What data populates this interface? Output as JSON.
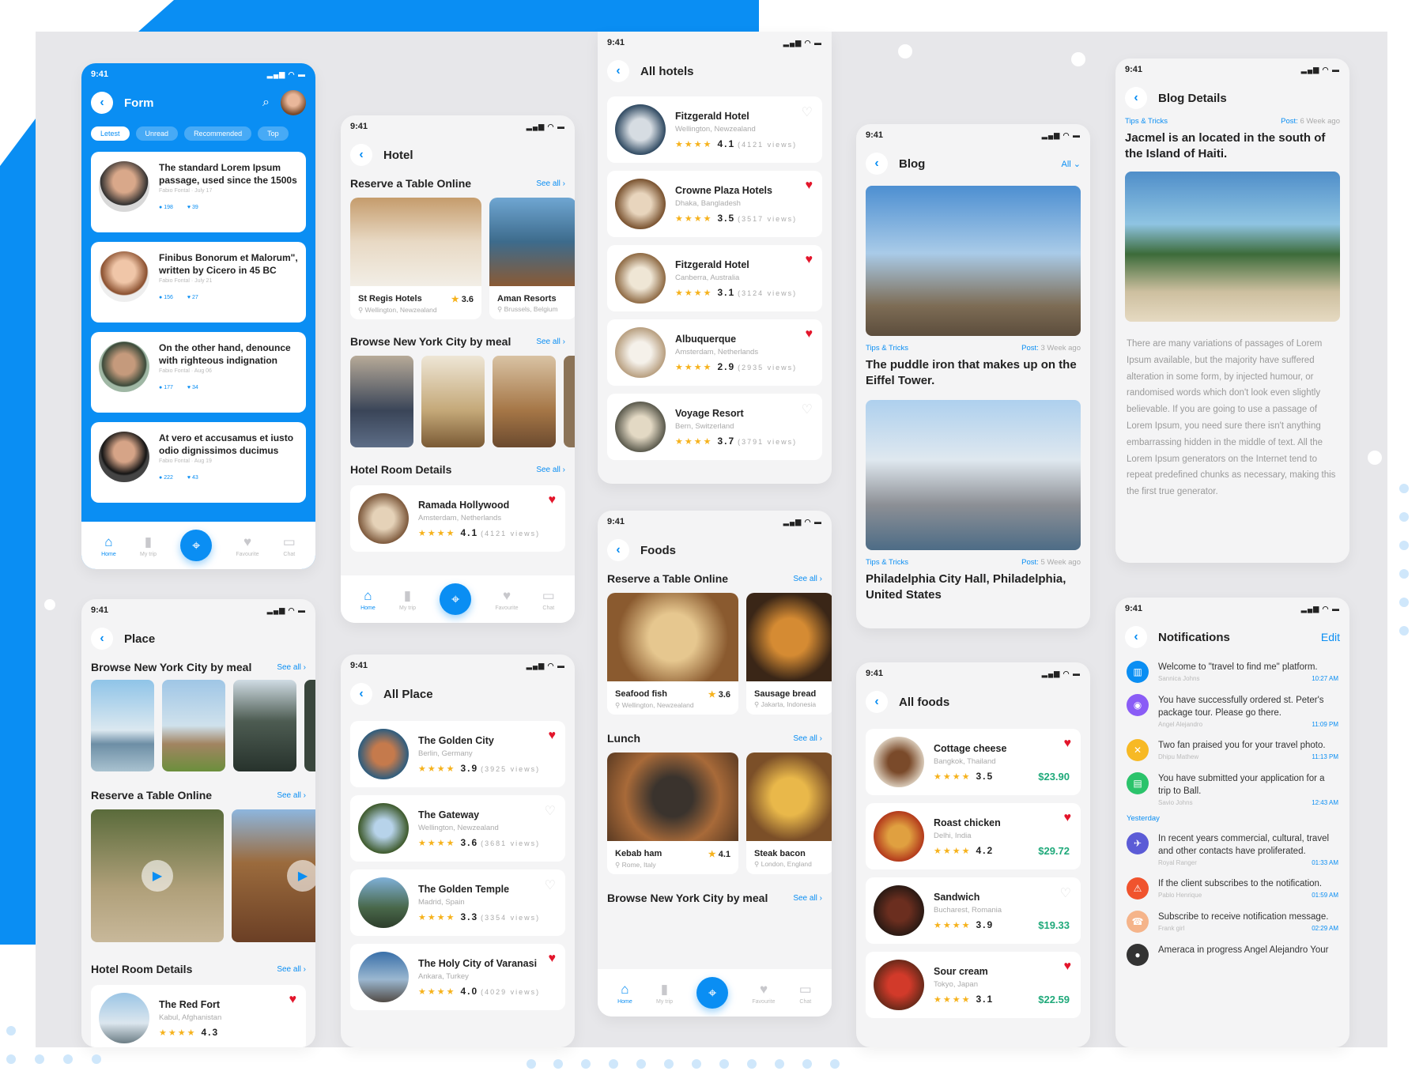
{
  "status_time": "9:41",
  "nav": {
    "home": "Home",
    "trip": "My trip",
    "fav": "Favourite",
    "chat": "Chat"
  },
  "see_all": "See all",
  "form": {
    "title": "Form",
    "tabs": [
      "Letest",
      "Unread",
      "Recommended",
      "Top"
    ],
    "posts": [
      {
        "title": "The standard Lorem Ipsum passage, used since the 1500s",
        "author": "Fabio Fontal",
        "date": "July 17",
        "comments": "198",
        "likes": "39"
      },
      {
        "title": "Finibus Bonorum et Malorum\", written by Cicero in 45 BC",
        "author": "Fabio Fontal",
        "date": "July 21",
        "comments": "156",
        "likes": "27"
      },
      {
        "title": "On the other hand, denounce with righteous indignation",
        "author": "Fabio Fontal",
        "date": "Aug 06",
        "comments": "177",
        "likes": "34"
      },
      {
        "title": "At vero et accusamus et iusto odio dignissimos ducimus",
        "author": "Fabio Fontal",
        "date": "Aug 19",
        "comments": "222",
        "likes": "43"
      }
    ]
  },
  "place": {
    "title": "Place",
    "s1": "Browse New York City by meal",
    "s2": "Reserve a Table Online",
    "s3": "Hotel Room Details",
    "card": {
      "name": "The Red Fort",
      "loc": "Kabul, Afghanistan",
      "rating": "4.3"
    }
  },
  "hotel": {
    "title": "Hotel",
    "s1": "Reserve a Table Online",
    "s2": "Browse New York City by meal",
    "s3": "Hotel Room Details",
    "c1": {
      "name": "St Regis Hotels",
      "loc": "Wellington, Newzealand",
      "rating": "3.6"
    },
    "c2": {
      "name": "Aman Resorts",
      "loc": "Brussels, Belgium"
    },
    "detail": {
      "name": "Ramada Hollywood",
      "loc": "Amsterdam, Netherlands",
      "rating": "4.1",
      "views": "(4121 views)"
    }
  },
  "all_place": {
    "title": "All Place",
    "items": [
      {
        "name": "The Golden City",
        "loc": "Berlin, Germany",
        "rating": "3.9",
        "views": "(3925 views)"
      },
      {
        "name": "The Gateway",
        "loc": "Wellington, Newzealand",
        "rating": "3.6",
        "views": "(3681 views)"
      },
      {
        "name": "The Golden Temple",
        "loc": "Madrid, Spain",
        "rating": "3.3",
        "views": "(3354 views)"
      },
      {
        "name": "The Holy City of Varanasi",
        "loc": "Ankara, Turkey",
        "rating": "4.0",
        "views": "(4029 views)"
      }
    ]
  },
  "all_hotels": {
    "title": "All hotels",
    "items": [
      {
        "name": "Fitzgerald Hotel",
        "loc": "Wellington, Newzealand",
        "rating": "4.1",
        "views": "(4121 views)"
      },
      {
        "name": "Crowne Plaza Hotels",
        "loc": "Dhaka, Bangladesh",
        "rating": "3.5",
        "views": "(3517 views)"
      },
      {
        "name": "Fitzgerald Hotel",
        "loc": "Canberra, Australia",
        "rating": "3.1",
        "views": "(3124 views)"
      },
      {
        "name": "Albuquerque",
        "loc": "Amsterdam, Netherlands",
        "rating": "2.9",
        "views": "(2935 views)"
      },
      {
        "name": "Voyage Resort",
        "loc": "Bern, Switzerland",
        "rating": "3.7",
        "views": "(3791 views)"
      }
    ]
  },
  "foods": {
    "title": "Foods",
    "s1": "Reserve a Table Online",
    "s2": "Lunch",
    "s3": "Browse New York City by meal",
    "c1": {
      "name": "Seafood fish",
      "loc": "Wellington, Newzealand",
      "rating": "3.6"
    },
    "c2": {
      "name": "Sausage bread",
      "loc": "Jakarta, Indonesia"
    },
    "c3": {
      "name": "Kebab ham",
      "loc": "Rome, Italy",
      "rating": "4.1"
    },
    "c4": {
      "name": "Steak bacon",
      "loc": "London, England"
    }
  },
  "blog": {
    "title": "Blog",
    "filter": "All",
    "tag": "Tips & Tricks",
    "post": "Post:",
    "a1": {
      "age": "3 Week ago",
      "title": "The puddle iron that makes up on the Eiffel Tower."
    },
    "a2": {
      "age": "5 Week ago",
      "title": "Philadelphia City Hall, Philadelphia, United States"
    }
  },
  "all_foods": {
    "title": "All foods",
    "items": [
      {
        "name": "Cottage cheese",
        "loc": "Bangkok, Thailand",
        "rating": "3.5",
        "price": "$23.90"
      },
      {
        "name": "Roast chicken",
        "loc": "Delhi, India",
        "rating": "4.2",
        "price": "$29.72"
      },
      {
        "name": "Sandwich",
        "loc": "Bucharest, Romania",
        "rating": "3.9",
        "price": "$19.33"
      },
      {
        "name": "Sour cream",
        "loc": "Tokyo, Japan",
        "rating": "3.1",
        "price": "$22.59"
      }
    ]
  },
  "blog_details": {
    "title": "Blog Details",
    "tag": "Tips & Tricks",
    "post": "Post:",
    "age": "6 Week ago",
    "heading": "Jacmel is an located in the south of the Island of Haiti.",
    "body": "There are many variations of passages of Lorem Ipsum available, but the majority have suffered alteration in some form, by injected humour, or randomised words which don't look even slightly believable. If you are going to use a passage of Lorem Ipsum, you need sure there isn't anything embarrassing hidden in the middle of text. All the Lorem Ipsum generators on the Internet tend to repeat predefined chunks as necessary, making this the first true generator."
  },
  "notifications": {
    "title": "Notifications",
    "edit": "Edit",
    "yesterday": "Yesterday",
    "items": [
      {
        "text": "Welcome to \"travel to find me\" platform.",
        "who": "Sannica Johns",
        "time": "10:27 AM",
        "color": "#0a8ef3"
      },
      {
        "text": "You have successfully ordered st. Peter's package tour. Please go there.",
        "who": "Angel Alejandro",
        "time": "11:09 PM",
        "color": "#8a5cf6"
      },
      {
        "text": "Two fan praised you for your travel photo.",
        "who": "Dhipu Mathew",
        "time": "11:13 PM",
        "color": "#f7b924"
      },
      {
        "text": "You have submitted your application for a trip to Ball.",
        "who": "Savio Johns",
        "time": "12:43 AM",
        "color": "#2bc36b"
      },
      {
        "text": "In recent years commercial, cultural, travel and other contacts have proliferated.",
        "who": "Royal Ranger",
        "time": "01:33 AM",
        "color": "#5b5bd6"
      },
      {
        "text": "If the client subscribes to the notification.",
        "who": "Pablo Henrique",
        "time": "01:59 AM",
        "color": "#f0532d"
      },
      {
        "text": "Subscribe to receive notification message.",
        "who": "Frank girl",
        "time": "02:29 AM",
        "color": "#f5b48a"
      },
      {
        "text": "Ameraca in progress Angel Alejandro Your",
        "who": "",
        "time": "",
        "color": "#333"
      }
    ]
  }
}
